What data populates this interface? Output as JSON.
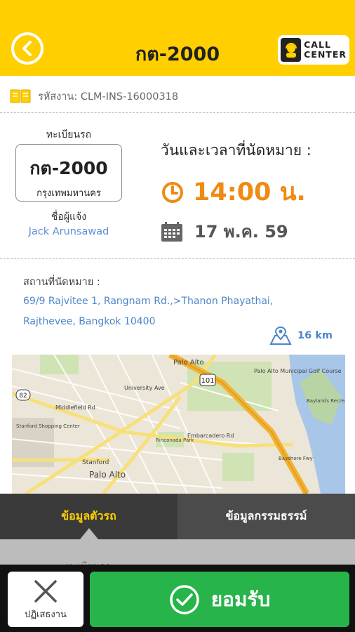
{
  "header": {
    "title": "กต-2000",
    "call_center_line1": "CALL",
    "call_center_line2": "CENTER"
  },
  "job": {
    "code": "รหัสงาน: CLM-INS-16000318"
  },
  "vehicle": {
    "plate_caption": "ทะเบียนรถ",
    "plate_number": "กต-2000",
    "plate_province": "กรุงเทพมหานคร",
    "reporter_caption": "ชื่อผู้แจ้ง",
    "reporter_name": "Jack  Arunsawad"
  },
  "appointment": {
    "label": "วันและเวลาที่นัดหมาย :",
    "time": "14:00 น.",
    "date": "17 พ.ค. 59"
  },
  "location": {
    "label": "สถานที่นัดหมาย :",
    "line1": "69/9 Rajvitee 1, Rangnam Rd.,>Thanon Phayathai,",
    "line2": "Rajthevee, Bangkok 10400",
    "distance": "16 km"
  },
  "map": {
    "labels": {
      "palo_alto_top": "Palo Alto",
      "municipal_golf": "Palo Alto Municipal Golf Course",
      "shopping_center": "Stanford Shopping Center",
      "stanford": "Stanford",
      "palo_alto_bottom": "Palo Alto",
      "hwy_101": "101",
      "hwy_82": "82",
      "embarcadero": "Embarcadero Rd",
      "middlefield": "Middlefield Rd",
      "university": "University Ave",
      "rinconada": "Rinconada Park",
      "bayshore": "Bayshore Fwy",
      "baylands": "Baylands Recreation Area"
    }
  },
  "tabs": {
    "active": "ข้อมูลตัวรถ",
    "inactive": "ข้อมูลกรรมธรรม์"
  },
  "under_panel": {
    "text": "ทะเบียนรถ"
  },
  "actions": {
    "reject": "ปฏิเสธงาน",
    "accept": "ยอมรับ"
  },
  "colors": {
    "header": "#ffcf00",
    "accent_orange": "#f08a12",
    "link_blue": "#4d86c8",
    "accept_green": "#27b44a"
  }
}
